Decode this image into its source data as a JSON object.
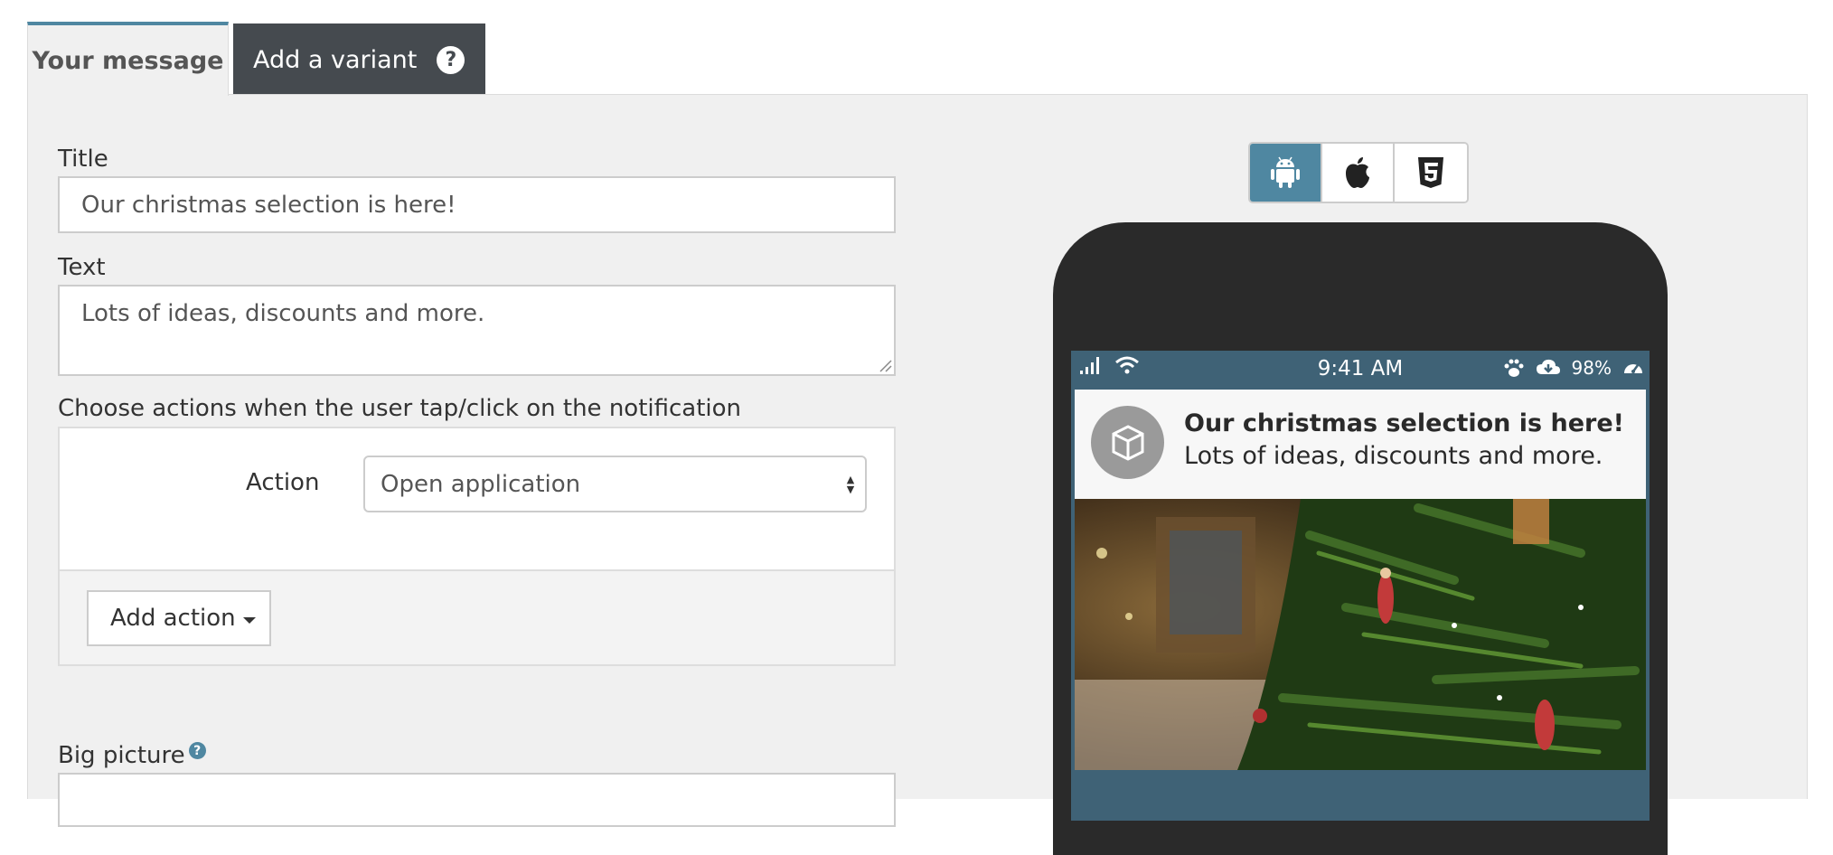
{
  "tabs": {
    "active_label": "Your message",
    "variant_label": "Add a variant",
    "help_glyph": "?"
  },
  "form": {
    "title_label": "Title",
    "title_value": "Our christmas selection is here!",
    "text_label": "Text",
    "text_value": "Lots of ideas, discounts and more.",
    "actions_label": "Choose actions when the user tap/click on the notification",
    "action_label": "Action",
    "action_value": "Open application",
    "add_action_label": "Add action",
    "big_picture_label": "Big picture",
    "info_glyph": "?"
  },
  "preview": {
    "platforms": [
      "android-icon",
      "apple-icon",
      "html5-icon"
    ],
    "active_platform": "android",
    "status_time": "9:41 AM",
    "battery": "98%",
    "notification_title": "Our christmas selection is here!",
    "notification_text": "Lots of ideas, discounts and more."
  },
  "colors": {
    "accent": "#4f87a1",
    "dark_tab": "#454a4f",
    "phone": "#2a2a2a",
    "status_bar": "#3f6276"
  }
}
